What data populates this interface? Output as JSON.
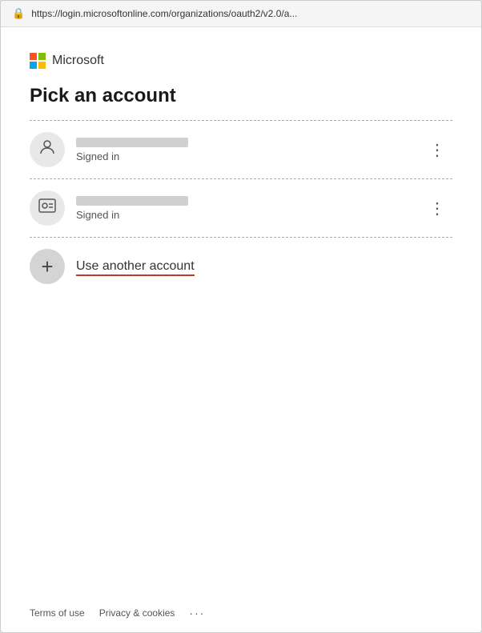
{
  "browser": {
    "url": "https://login.microsoftonline.com/organizations/oauth2/v2.0/a...",
    "lock_icon": "🔒"
  },
  "microsoft": {
    "logo_text": "Microsoft",
    "colors": {
      "red": "#f35325",
      "green": "#81bc06",
      "blue": "#05a6f0",
      "yellow": "#ffba08"
    }
  },
  "page": {
    "title": "Pick an account"
  },
  "accounts": [
    {
      "id": "account-1",
      "status": "Signed in",
      "has_name_bar": true,
      "icon_type": "person",
      "show_more": true
    },
    {
      "id": "account-2",
      "status": "Signed in",
      "has_name_bar": true,
      "icon_type": "id-card",
      "show_more": true
    }
  ],
  "use_another": {
    "label": "Use another account"
  },
  "footer": {
    "terms_label": "Terms of use",
    "privacy_label": "Privacy & cookies",
    "more_label": "···"
  }
}
